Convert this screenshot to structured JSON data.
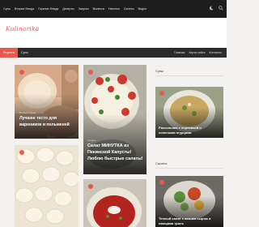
{
  "topbar": {
    "nav": [
      "Супы",
      "Вторые блюда",
      "Горячие блюда",
      "Десерты",
      "Закуски",
      "Выпечка",
      "Напитки",
      "Салаты",
      "Видео"
    ]
  },
  "header": {
    "logo": "Kulinarika"
  },
  "catnav": {
    "active": "Рецепты",
    "second": "Супы",
    "right": [
      "Главная",
      "Карта сайта",
      "Контакты"
    ]
  },
  "cards": [
    {
      "title_line1": "Лучшее тесто для",
      "title_line2": "вареников и пельменей",
      "meta": "Вторые блюда"
    },
    {
      "title_line1": "Салат МИНУТКА из",
      "title_line2": "Пекинской Капусты!",
      "title_line3": "Люблю быстрые салаты!",
      "meta": "Салаты"
    }
  ],
  "sidebar": {
    "section1": "Супы",
    "card1": {
      "title_line1": "Рассольник с перловкой и",
      "title_line2": "солеными огурцами"
    },
    "section2": "Салаты",
    "card2": {
      "title_line1": "Теплый салат с козьим сыром и",
      "title_line2": "овощами гриль"
    }
  },
  "colors": {
    "accent": "#e95a4e",
    "topbar": "#1d1d1d",
    "catnav": "#2b2b2b"
  }
}
